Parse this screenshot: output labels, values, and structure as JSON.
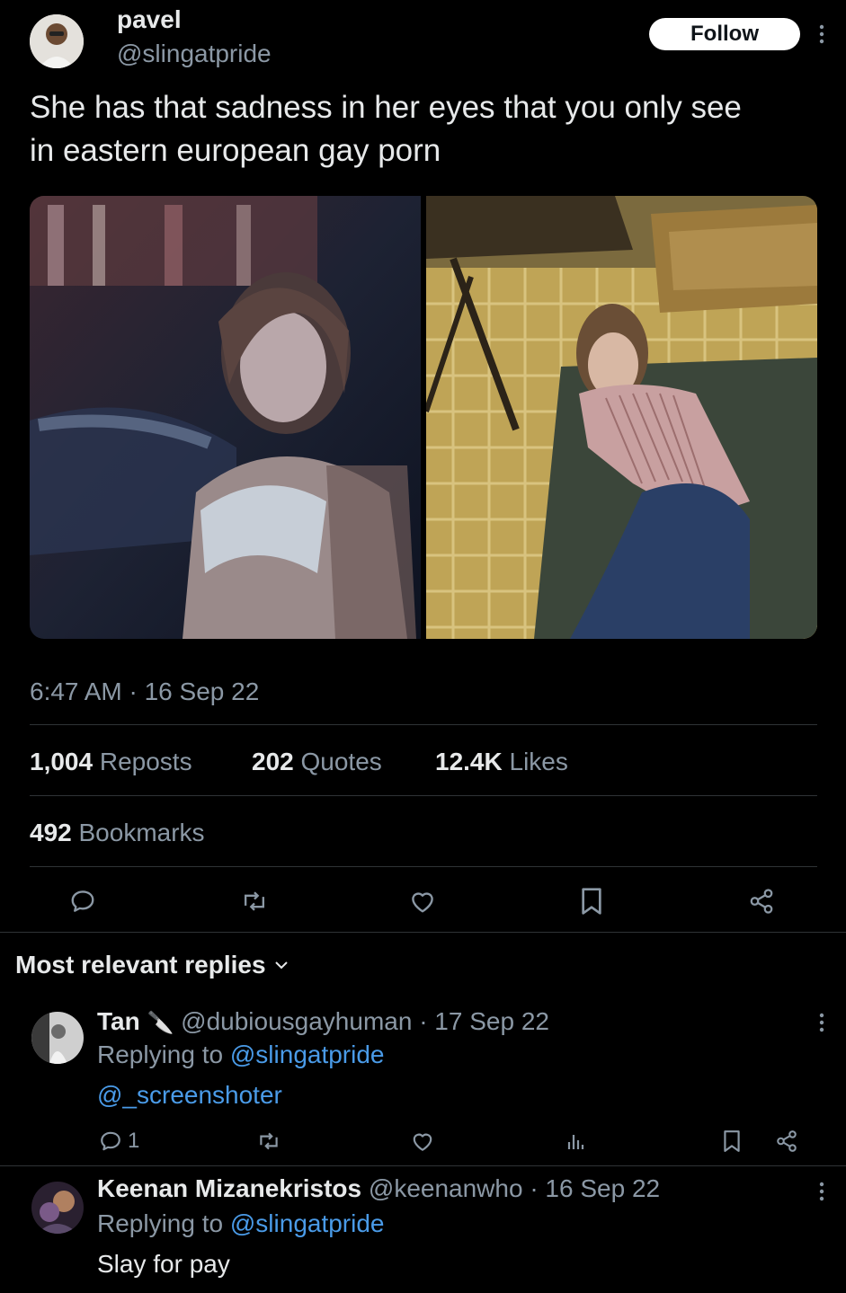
{
  "tweet": {
    "author_name": "pavel",
    "author_handle": "@slingatpride",
    "follow_label": "Follow",
    "text_line1": "She has that sadness in her eyes that you only see",
    "text_line2": "in eastern european gay porn",
    "timestamp": "6:47 AM · 16 Sep 22",
    "stats": {
      "reposts_count": "1,004",
      "reposts_label": "Reposts",
      "quotes_count": "202",
      "quotes_label": "Quotes",
      "likes_count": "12.4K",
      "likes_label": "Likes",
      "bookmarks_count": "492",
      "bookmarks_label": "Bookmarks"
    }
  },
  "replies_header": "Most relevant replies",
  "replies": [
    {
      "name": "Tan",
      "emoji": "🔪",
      "handle_date": "@dubiousgayhuman · 17 Sep 22",
      "replying_prefix": "Replying to",
      "replying_handle": "@slingatpride",
      "text": "@_screenshoter",
      "reply_count": "1"
    },
    {
      "name": "Keenan Mizanekristos",
      "handle_date": "@keenanwho · 16 Sep 22",
      "replying_prefix": "Replying to",
      "replying_handle": "@slingatpride",
      "text": "Slay for pay"
    }
  ]
}
